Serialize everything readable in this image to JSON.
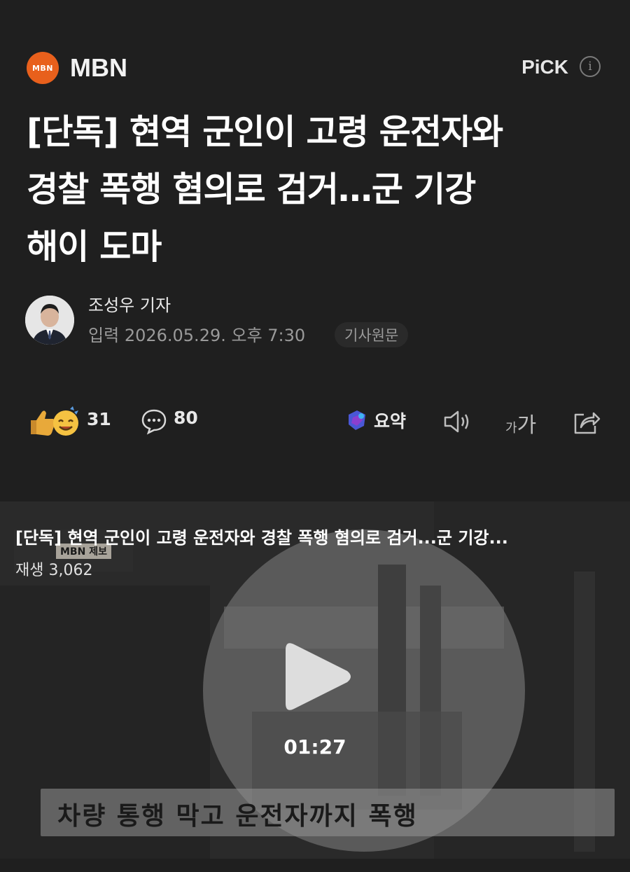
{
  "press": {
    "logo_text": "MBN",
    "name": "MBN",
    "pick_label": "PiCK",
    "info_icon": "info-icon"
  },
  "article": {
    "headline_lines": [
      "[단독] 현역 군인이 고령 운전자와",
      "경찰 폭행 혐의로 검거…군 기강",
      "해이 도마"
    ]
  },
  "byline": {
    "reporter": "조성우 기자",
    "input_label": "입력",
    "date": "2026.05.29. 오후 7:30",
    "original_link": "기사원문"
  },
  "actions": {
    "reaction_count": "31",
    "comment_count": "80",
    "summary_label": "요약",
    "font_small": "가",
    "font_big": "가"
  },
  "video": {
    "title": "[단독] 현역 군인이 고령 운전자와 경찰 폭행 혐의로 검거...군 기강...",
    "plays": "재생 3,062",
    "duration": "01:27",
    "caption": "차량 통행 막고 운전자까지 폭행",
    "tag": "MBN 제보"
  },
  "colors": {
    "background": "#1f1f1f",
    "logo": "#e8601c",
    "secondary_text": "#9a9a9a"
  }
}
